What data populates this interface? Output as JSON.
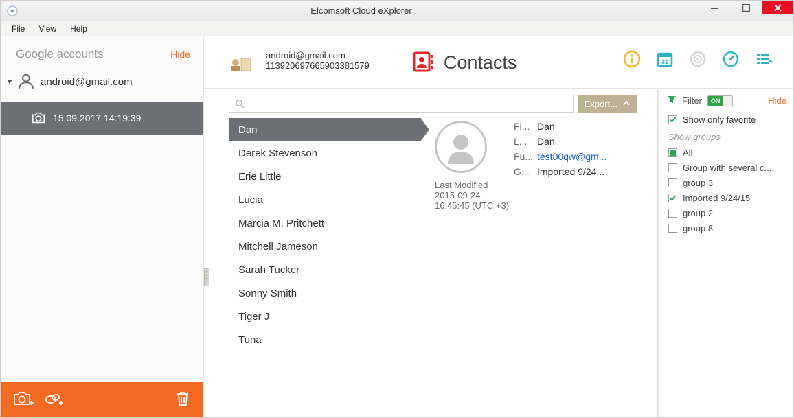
{
  "windowTitle": "Elcomsoft Cloud eXplorer",
  "menu": [
    "File",
    "View",
    "Help"
  ],
  "sidebar": {
    "title": "Google accounts",
    "hide": "Hide",
    "account": "android@gmail.com",
    "snapshot": "15.09.2017 14:19:39"
  },
  "account": {
    "email": "android@gmail.com",
    "id": "113920697665903381579"
  },
  "section": {
    "title": "Contacts"
  },
  "search": {
    "placeholder": ""
  },
  "export": {
    "label": "Export..."
  },
  "contacts": {
    "selectedIndex": 0,
    "items": [
      "Dan",
      "Derek Stevenson",
      "Erie Little",
      "Lucia",
      "Marcia M. Pritchett",
      "Mitchell Jameson",
      "Sarah Tucker",
      "Sonny Smith",
      "Tiger J",
      "Tuna"
    ]
  },
  "detail": {
    "lastModifiedLabel": "Last Modified",
    "lastModifiedDate": "2015-09-24",
    "lastModifiedTime": "16:45:45 (UTC +3)",
    "fields": [
      {
        "label": "Fi...",
        "value": "Dan"
      },
      {
        "label": "L...",
        "value": "Dan"
      },
      {
        "label": "Fu...",
        "value": "test00qw@gm...",
        "link": true
      },
      {
        "label": "G...",
        "value": "Imported 9/24..."
      }
    ]
  },
  "filter": {
    "label": "Filter",
    "toggle": "ON",
    "hide": "Hide",
    "showFavorite": "Show only favorite",
    "showFavoriteChecked": true,
    "showGroups": "Show groups",
    "groups": [
      {
        "label": "All",
        "state": "square"
      },
      {
        "label": "Group with several c...",
        "state": ""
      },
      {
        "label": "group 3",
        "state": ""
      },
      {
        "label": "Imported 9/24/15",
        "state": "checked"
      },
      {
        "label": "group 2",
        "state": ""
      },
      {
        "label": "group 8",
        "state": ""
      }
    ]
  }
}
